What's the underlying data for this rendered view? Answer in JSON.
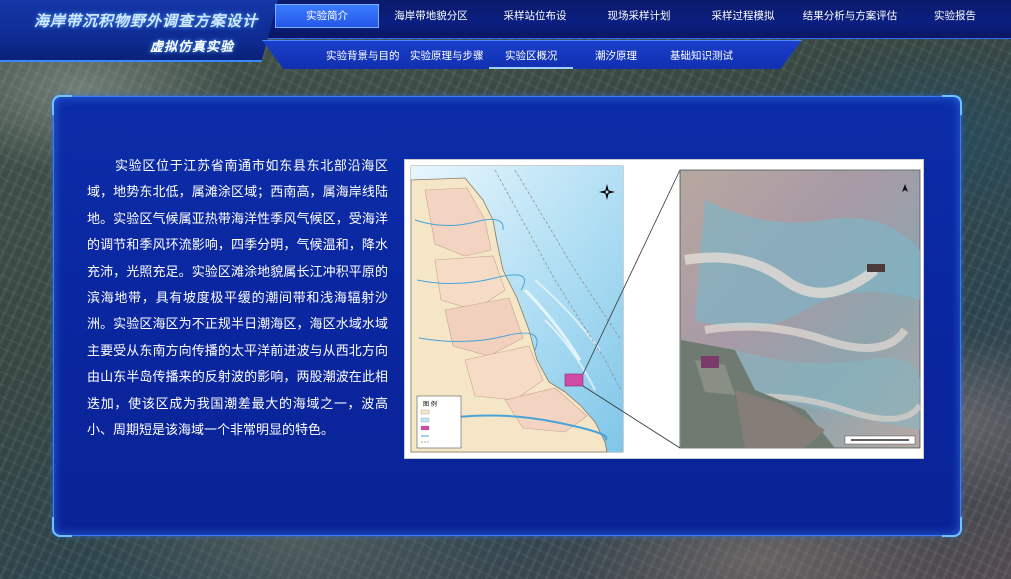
{
  "app": {
    "title": "海岸带沉积物野外调查方案设计",
    "subtitle": "虚拟仿真实验"
  },
  "main_nav": [
    {
      "label": "实验简介",
      "active": true
    },
    {
      "label": "海岸带地貌分区",
      "active": false
    },
    {
      "label": "采样站位布设",
      "active": false
    },
    {
      "label": "现场采样计划",
      "active": false
    },
    {
      "label": "采样过程模拟",
      "active": false
    },
    {
      "label": "结果分析与方案评估",
      "active": false
    },
    {
      "label": "实验报告",
      "active": false
    }
  ],
  "sub_nav": [
    {
      "label": "实验背景与目的",
      "active": false
    },
    {
      "label": "实验原理与步骤",
      "active": false
    },
    {
      "label": "实验区概况",
      "active": true
    },
    {
      "label": "潮汐原理",
      "active": false
    },
    {
      "label": "基础知识测试",
      "active": false
    }
  ],
  "content": {
    "paragraph": "实验区位于江苏省南通市如东县东北部沿海区域，地势东北低，属滩涂区域；西南高，属海岸线陆地。实验区气候属亚热带海洋性季风气候区，受海洋的调节和季风环流影响，四季分明，气候温和，降水充沛，光照充足。实验区滩涂地貌属长江冲积平原的滨海地带，具有坡度极平缓的潮间带和浅海辐射沙洲。实验区海区为不正规半日潮海区，海区水域水域主要受从东南方向传播的太平洋前进波与从西北方向由山东半岛传播来的反射波的影响，两股潮波在此相迭加，使该区成为我国潮差最大的海域之一，波高小、周期短是该海域一个非常明显的特色。"
  },
  "figure": {
    "legend_title": "图 例",
    "compass_icon": "north-arrow-icon"
  },
  "colors": {
    "nav_bg": "#0b1f82",
    "panel_bg": "#0a26a0",
    "accent": "#3c7bff",
    "active_tab": "#2f63f0"
  }
}
